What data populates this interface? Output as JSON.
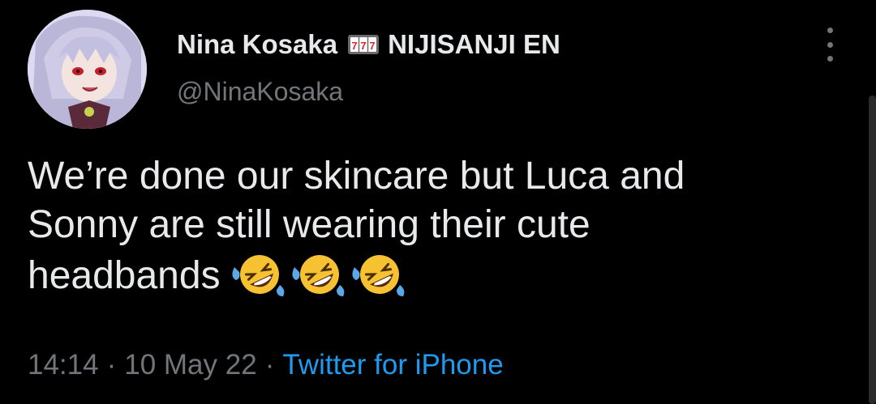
{
  "tweet": {
    "author": {
      "display_name": "Nina Kosaka",
      "badge_icon": "slot-machine-777-icon",
      "org_name": "NIJISANJI EN",
      "handle": "@NinaKosaka",
      "avatar": "avatar-image"
    },
    "text_lines": [
      "We’re done our skincare but Luca and",
      "Sonny are still wearing their cute",
      "headbands"
    ],
    "emojis": [
      "rolling-on-floor-laughing-emoji",
      "rolling-on-floor-laughing-emoji",
      "rolling-on-floor-laughing-emoji"
    ],
    "meta": {
      "time": "14:14",
      "separator": "·",
      "date": "10 May 22",
      "source": "Twitter for iPhone"
    }
  },
  "colors": {
    "background": "#000000",
    "primary_text": "#e7e9ea",
    "secondary_text": "#71767b",
    "link": "#1d9bf0"
  },
  "icons": {
    "more": "more-vertical-icon"
  }
}
